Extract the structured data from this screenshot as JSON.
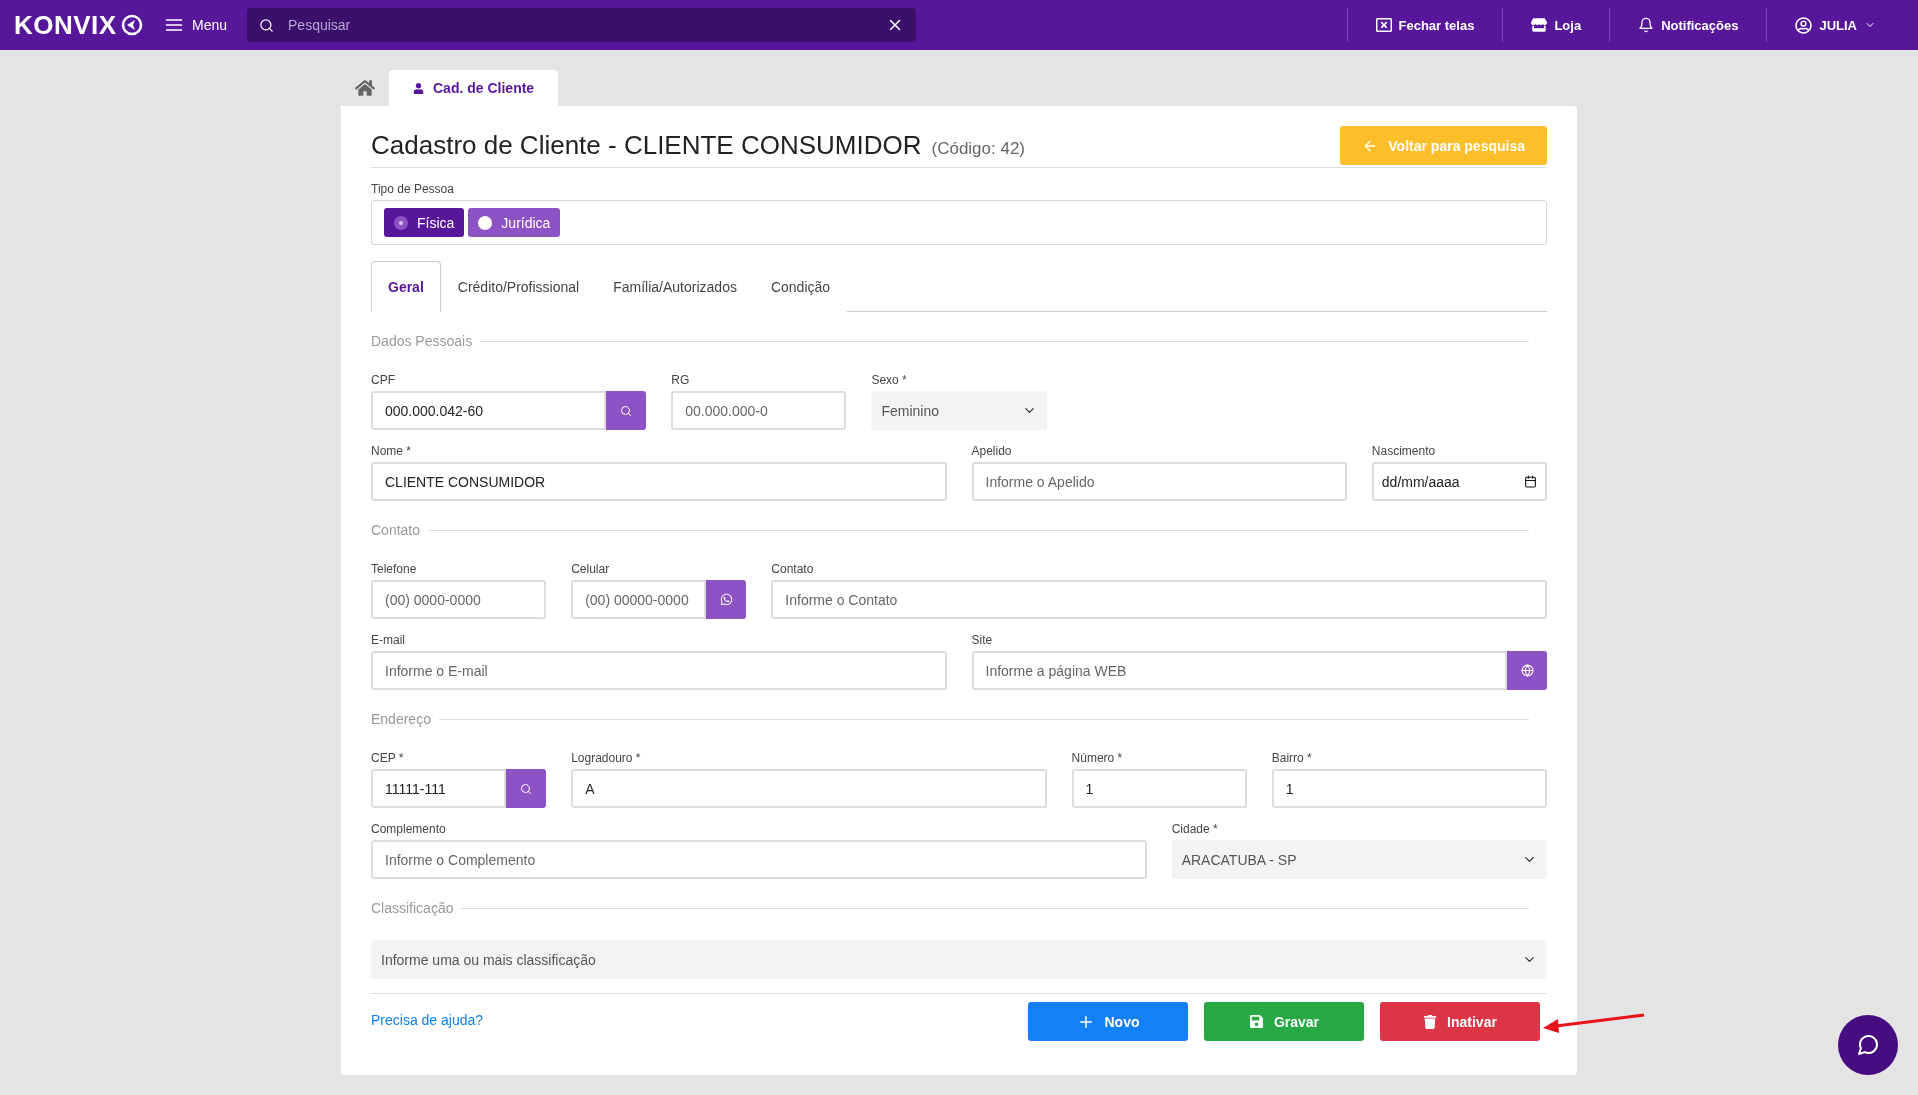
{
  "topbar": {
    "logo": "KONVIX",
    "menu": "Menu",
    "search": {
      "placeholder": "Pesquisar"
    },
    "actions": [
      {
        "kind": "close-screens",
        "label": "Fechar telas"
      },
      {
        "kind": "store",
        "label": "Loja"
      },
      {
        "kind": "bell",
        "label": "Notificações"
      },
      {
        "kind": "user",
        "label": "JULIA"
      }
    ]
  },
  "breadcrumb": {
    "tab": "Cad. de Cliente"
  },
  "header": {
    "title": "Cadastro de Cliente - CLIENTE CONSUMIDOR",
    "code": "(Código: 42)",
    "back_button": "Voltar para pesquisa"
  },
  "person_type": {
    "label": "Tipo de Pessoa",
    "options": [
      {
        "label": "Física",
        "selected": true
      },
      {
        "label": "Jurídica",
        "selected": false
      }
    ]
  },
  "tabs": [
    {
      "label": "Geral",
      "selected": true
    },
    {
      "label": "Crédito/Profissional",
      "selected": false
    },
    {
      "label": "Família/Autorizados",
      "selected": false
    },
    {
      "label": "Condição",
      "selected": false
    }
  ],
  "sections": [
    {
      "title": "Dados Pessoais",
      "rows": [
        [
          {
            "kind": "input-search",
            "label": "CPF",
            "value": "000.000.042-60"
          },
          {
            "kind": "input",
            "label": "RG",
            "placeholder": "00.000.000-0"
          },
          {
            "kind": "select",
            "label": "Sexo *",
            "value": "Feminino"
          }
        ],
        [
          {
            "kind": "input",
            "label": "Nome *",
            "value": "CLIENTE CONSUMIDOR"
          },
          {
            "kind": "input",
            "label": "Apelido",
            "placeholder": "Informe o Apelido"
          },
          {
            "kind": "date",
            "label": "Nascimento",
            "value": "dd/mm/aaaa"
          }
        ]
      ]
    },
    {
      "title": "Contato",
      "rows": [
        [
          {
            "kind": "input",
            "label": "Telefone",
            "placeholder": "(00) 0000-0000"
          },
          {
            "kind": "input-whatsapp",
            "label": "Celular",
            "placeholder": "(00) 00000-0000"
          },
          {
            "kind": "input",
            "label": "Contato",
            "placeholder": "Informe o Contato"
          }
        ],
        [
          {
            "kind": "input",
            "label": "E-mail",
            "placeholder": "Informe o E-mail"
          },
          {
            "kind": "input-web",
            "label": "Site",
            "placeholder": "Informe a página WEB"
          }
        ]
      ]
    },
    {
      "title": "Endereço",
      "rows": [
        [
          {
            "kind": "input-search",
            "label": "CEP *",
            "value": "11111-111"
          },
          {
            "kind": "input",
            "label": "Logradouro *",
            "value": "A"
          },
          {
            "kind": "input",
            "label": "Número *",
            "value": "1"
          },
          {
            "kind": "input",
            "label": "Bairro *",
            "value": "1"
          }
        ],
        [
          {
            "kind": "input",
            "label": "Complemento",
            "placeholder": "Informe o Complemento"
          },
          {
            "kind": "select",
            "label": "Cidade *",
            "value": "ARACATUBA - SP"
          }
        ]
      ]
    },
    {
      "title": "Classificação",
      "rows": [
        [
          {
            "kind": "select",
            "placeholder": "Informe uma ou mais classificação"
          }
        ]
      ]
    }
  ],
  "footer": {
    "help_link": "Precisa de ajuda?",
    "buttons": [
      {
        "kind": "new",
        "label": "Novo"
      },
      {
        "kind": "save",
        "label": "Gravar"
      },
      {
        "kind": "delete",
        "label": "Inativar"
      }
    ]
  }
}
